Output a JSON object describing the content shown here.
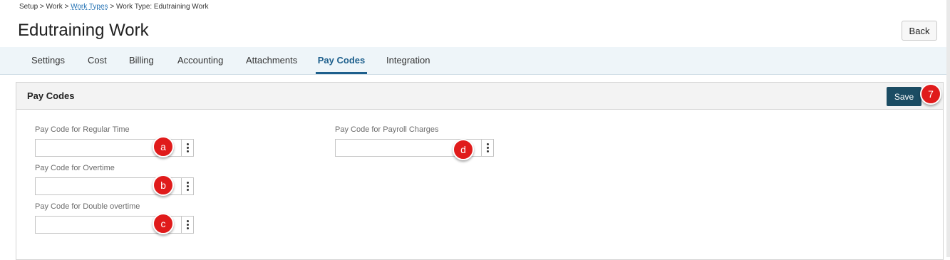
{
  "breadcrumb": {
    "part1": "Setup",
    "sep1": ">",
    "part2": "Work",
    "sep2": ">",
    "link": "Work Types",
    "sep3": ">",
    "current": "Work Type: Edutraining Work"
  },
  "page": {
    "title": "Edutraining Work",
    "back_label": "Back"
  },
  "tabs": [
    {
      "label": "Settings"
    },
    {
      "label": "Cost"
    },
    {
      "label": "Billing"
    },
    {
      "label": "Accounting"
    },
    {
      "label": "Attachments"
    },
    {
      "label": "Pay Codes"
    },
    {
      "label": "Integration"
    }
  ],
  "active_tab": "Pay Codes",
  "card": {
    "title": "Pay Codes",
    "save_label": "Save"
  },
  "fields": [
    {
      "label": "Pay Code for Regular Time",
      "value": "",
      "callout": "a"
    },
    {
      "label": "Pay Code for Overtime",
      "value": "",
      "callout": "b"
    },
    {
      "label": "Pay Code for Double overtime",
      "value": "",
      "callout": "c"
    },
    {
      "label": "Pay Code for Payroll Charges",
      "value": "",
      "callout": "d"
    }
  ],
  "save_callout": "7",
  "colors": {
    "accent": "#1d5f8c",
    "save_bg": "#1b4c63",
    "callout": "#e01b1b",
    "tabbar_bg": "#eef5f9"
  }
}
